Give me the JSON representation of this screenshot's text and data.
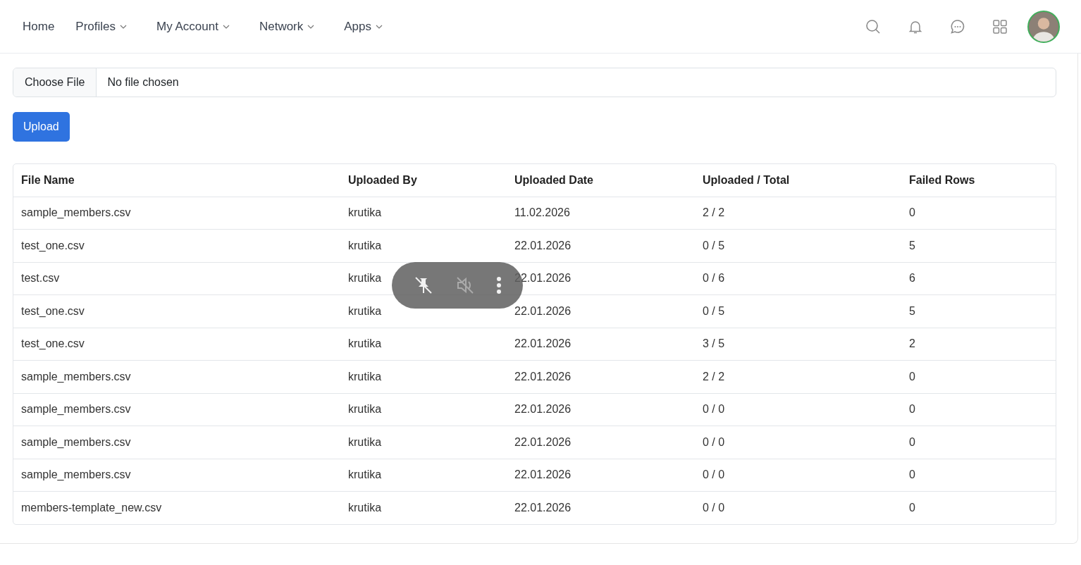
{
  "nav": {
    "items": [
      {
        "label": "Home",
        "dropdown": false
      },
      {
        "label": "Profiles",
        "dropdown": true
      },
      {
        "label": "My Account",
        "dropdown": true
      },
      {
        "label": "Network",
        "dropdown": true
      },
      {
        "label": "Apps",
        "dropdown": true
      }
    ]
  },
  "upload": {
    "choose_label": "Choose File",
    "file_status": "No file chosen",
    "button": "Upload"
  },
  "table": {
    "columns": [
      "File Name",
      "Uploaded By",
      "Uploaded Date",
      "Uploaded / Total",
      "Failed Rows"
    ],
    "rows": [
      [
        "sample_members.csv",
        "krutika",
        "11.02.2026",
        "2 / 2",
        "0"
      ],
      [
        "test_one.csv",
        "krutika",
        "22.01.2026",
        "0 / 5",
        "5"
      ],
      [
        "test.csv",
        "krutika",
        "22.01.2026",
        "0 / 6",
        "6"
      ],
      [
        "test_one.csv",
        "krutika",
        "22.01.2026",
        "0 / 5",
        "5"
      ],
      [
        "test_one.csv",
        "krutika",
        "22.01.2026",
        "3 / 5",
        "2"
      ],
      [
        "sample_members.csv",
        "krutika",
        "22.01.2026",
        "2 / 2",
        "0"
      ],
      [
        "sample_members.csv",
        "krutika",
        "22.01.2026",
        "0 / 0",
        "0"
      ],
      [
        "sample_members.csv",
        "krutika",
        "22.01.2026",
        "0 / 0",
        "0"
      ],
      [
        "sample_members.csv",
        "krutika",
        "22.01.2026",
        "0 / 0",
        "0"
      ],
      [
        "members-template_new.csv",
        "krutika",
        "22.01.2026",
        "0 / 0",
        "0"
      ]
    ]
  },
  "media_overlay": {
    "muted": true
  }
}
